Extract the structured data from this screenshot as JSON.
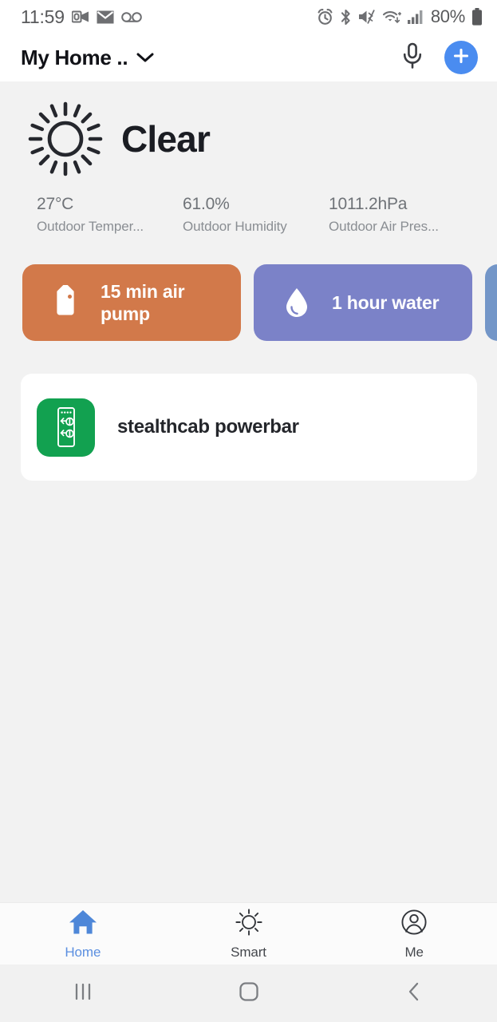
{
  "status_bar": {
    "time": "11:59",
    "battery_percent": "80%",
    "left_icons": [
      "outlook-icon",
      "mail-icon",
      "voicemail-icon"
    ],
    "right_icons": [
      "alarm-icon",
      "bluetooth-icon",
      "mute-vibrate-icon",
      "wifi-icon",
      "signal-icon",
      "battery-icon"
    ]
  },
  "app_bar": {
    "home_name": "My Home ..",
    "dropdown_icon": "chevron-down-icon",
    "mic_icon": "microphone-icon",
    "add_icon": "plus-icon",
    "add_button_color": "#4a8cf0"
  },
  "weather": {
    "condition": "Clear",
    "icon": "sun-icon",
    "stats": [
      {
        "value": "27°C",
        "label": "Outdoor Temper..."
      },
      {
        "value": "61.0%",
        "label": "Outdoor Humidity"
      },
      {
        "value": "1011.2hPa",
        "label": "Outdoor Air Pres..."
      }
    ]
  },
  "scenes": [
    {
      "label": "15 min air pump",
      "icon": "tag-icon",
      "color": "#d2794a"
    },
    {
      "label": "1 hour water",
      "icon": "water-drop-icon",
      "color": "#7b82c8"
    },
    {
      "label": "",
      "icon": "",
      "color": "#7396c8"
    }
  ],
  "devices": [
    {
      "name": "stealthcab powerbar",
      "icon": "powerbar-icon",
      "icon_color": "#12a150"
    }
  ],
  "bottom_nav": {
    "items": [
      {
        "label": "Home",
        "icon": "home-icon",
        "active": true
      },
      {
        "label": "Smart",
        "icon": "sun-small-icon",
        "active": false
      },
      {
        "label": "Me",
        "icon": "account-icon",
        "active": false
      }
    ],
    "active_color": "#5b8fe0"
  },
  "system_nav": {
    "recents_icon": "recents-icon",
    "home_icon": "home-square-icon",
    "back_icon": "back-chevron-icon"
  }
}
